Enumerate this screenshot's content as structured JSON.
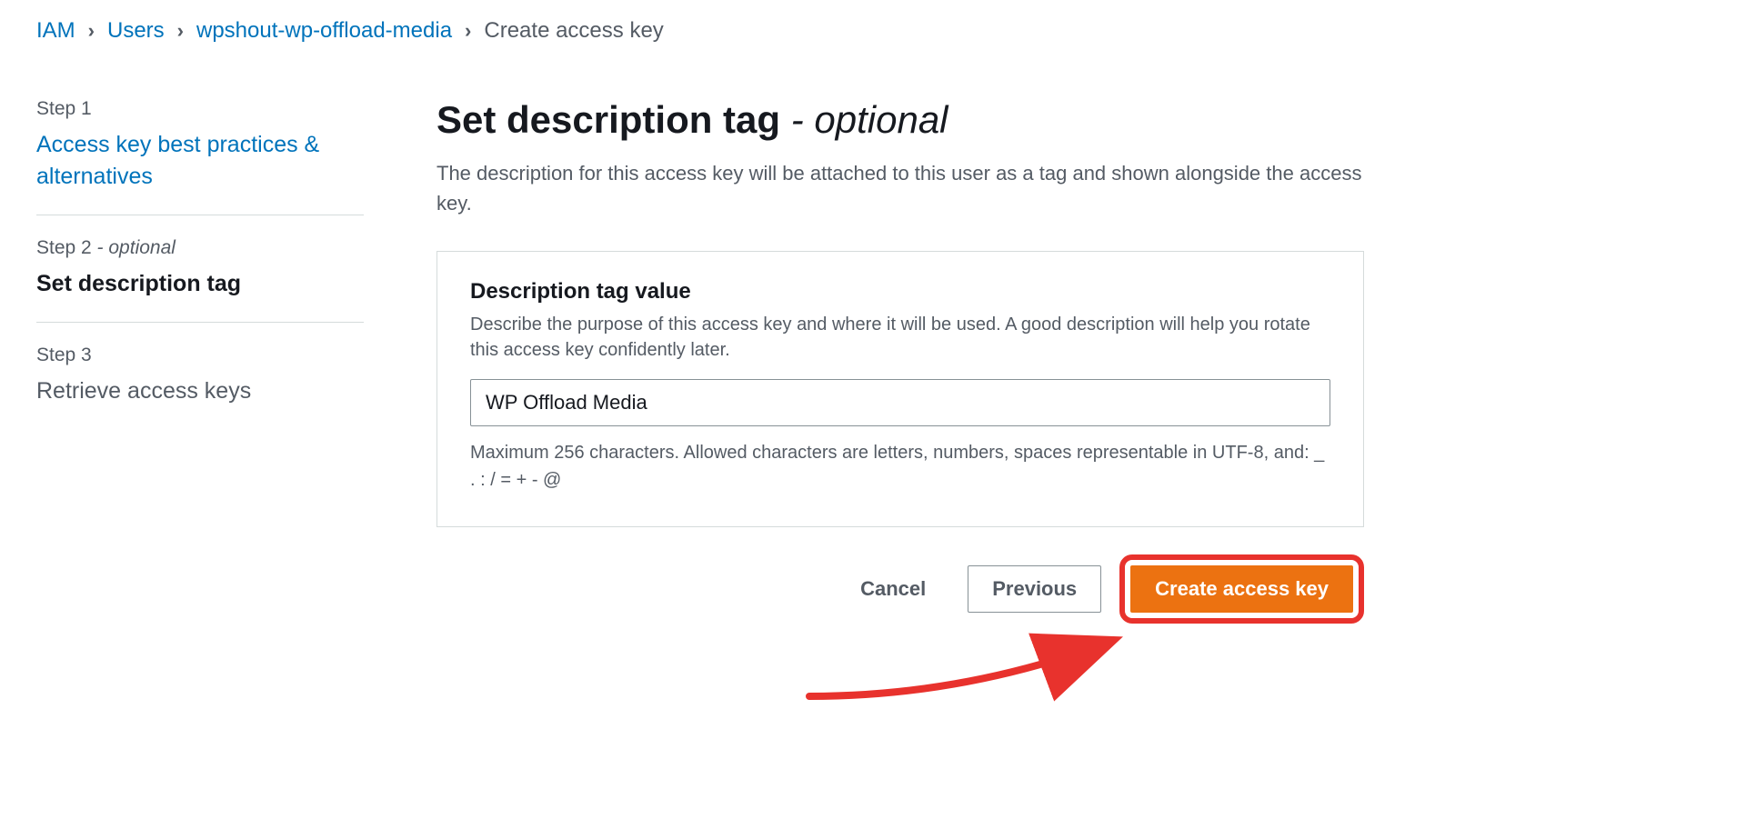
{
  "breadcrumb": {
    "items": [
      "IAM",
      "Users",
      "wpshout-wp-offload-media"
    ],
    "current": "Create access key"
  },
  "steps": [
    {
      "label": "Step 1",
      "optional": "",
      "title": "Access key best practices & alternatives",
      "link": true,
      "active": false
    },
    {
      "label": "Step 2",
      "optional": " - optional",
      "title": "Set description tag",
      "link": false,
      "active": true
    },
    {
      "label": "Step 3",
      "optional": "",
      "title": "Retrieve access keys",
      "link": false,
      "active": false
    }
  ],
  "page": {
    "title_prefix": "Set description tag ",
    "title_sep": "- ",
    "title_optional": "optional",
    "description": "The description for this access key will be attached to this user as a tag and shown alongside the access key."
  },
  "form": {
    "field_label": "Description tag value",
    "field_helper": "Describe the purpose of this access key and where it will be used. A good description will help you rotate this access key confidently later.",
    "field_value": "WP Offload Media",
    "field_constraints": "Maximum 256 characters. Allowed characters are letters, numbers, spaces representable in UTF-8, and: _ . : / = + - @"
  },
  "actions": {
    "cancel": "Cancel",
    "previous": "Previous",
    "create": "Create access key"
  }
}
